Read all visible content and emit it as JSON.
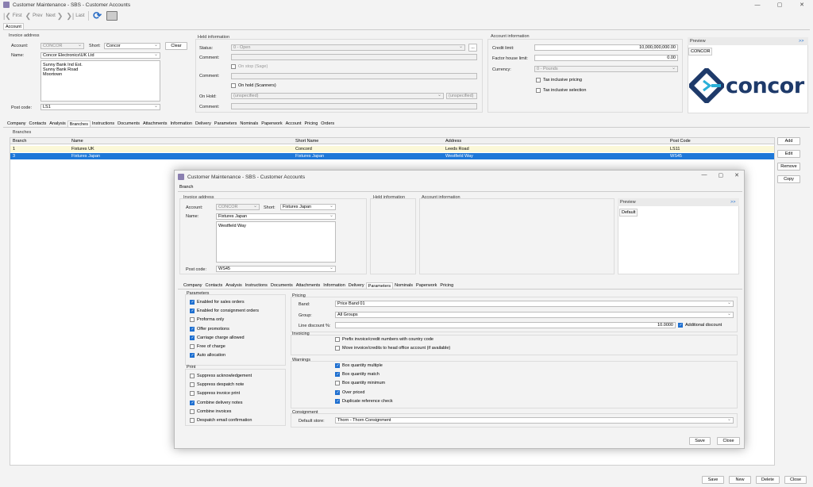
{
  "window": {
    "title": "Customer Maintenance - SBS - Customer Accounts",
    "min": "—",
    "max": "▢",
    "close": "✕"
  },
  "toolbar": {
    "first": "First",
    "prev": "Prev",
    "next": "Next",
    "last": "Last"
  },
  "top_tab": "Account",
  "invoice_address": {
    "title": "Invoice address",
    "account_label": "Account:",
    "account_value": "CONCOR",
    "short_label": "Short:",
    "short_value": "Concor",
    "clear_label": "Clear",
    "name_label": "Name:",
    "name_value": "Concor Electronics\\UK Ltd",
    "address_lines": [
      "Sunny Bank Ind Est.",
      "Sunny Bank Road",
      "Moortown"
    ],
    "postcode_label": "Post code:",
    "postcode_value": "LS1"
  },
  "held_information": {
    "title": "Held information",
    "status_label": "Status:",
    "status_value": "0 - Open",
    "comment_label": "Comment:",
    "on_stop_label": "On stop (Sage)",
    "on_hold_scanners_label": "On hold (Scanners)",
    "on_hold_label": "On Hold:",
    "on_hold_value": "(unspecified)",
    "on_hold_value2": "(unspecified)",
    "ellipsis": "..."
  },
  "account_information": {
    "title": "Account information",
    "credit_limit_label": "Credit limit:",
    "credit_limit_value": "10,000,000,000.00",
    "factor_label": "Factor house limit:",
    "factor_value": "0.00",
    "currency_label": "Currency:",
    "currency_value": "0 - Pounds",
    "tax_inclusive_pricing": "Tax inclusive pricing",
    "tax_inclusive_selection": "Tax inclusive selection"
  },
  "preview": {
    "title": "Preview",
    "expand": ">>",
    "tab": "CONCOR",
    "logo_text": "concor"
  },
  "main_tabs": [
    "Company",
    "Contacts",
    "Analysis",
    "Branches",
    "Instructions",
    "Documents",
    "Attachments",
    "Information",
    "Delivery",
    "Parameters",
    "Nominals",
    "Paperwork",
    "Account",
    "Pricing",
    "Orders"
  ],
  "branches": {
    "title": "Branches",
    "columns": [
      "Branch",
      "Name",
      "Short Name",
      "Address",
      "Post Code"
    ],
    "rows": [
      [
        "1",
        "Fixtures UK",
        "Concord",
        "Leeds Road",
        "LS11"
      ],
      [
        "3",
        "Fixtures Japan",
        "Fixtures Japan",
        "Westfield Way",
        "WS45"
      ]
    ],
    "buttons": [
      "Add",
      "Edit",
      "Remove",
      "Copy"
    ]
  },
  "footer_buttons": [
    "Save",
    "New",
    "Delete",
    "Close"
  ],
  "dialog": {
    "title": "Customer Maintenance - SBS - Customer Accounts",
    "top_tab": "Branch",
    "invoice_title": "Invoice address",
    "account_label": "Account:",
    "account_value": "CONCOR",
    "short_label": "Short:",
    "short_value": "Fixtures Japan",
    "name_label": "Name:",
    "name_value": "Fixtures Japan",
    "address_lines": [
      "Westfield Way"
    ],
    "postcode_label": "Post code:",
    "postcode_value": "WS45",
    "held_title": "Held information",
    "account_title": "Account information",
    "preview_title": "Preview",
    "preview_expand": ">>",
    "preview_tab": "Default",
    "tabs": [
      "Company",
      "Contacts",
      "Analysis",
      "Instructions",
      "Documents",
      "Attachments",
      "Information",
      "Delivery",
      "Parameters",
      "Nominals",
      "Paperwork",
      "Pricing"
    ],
    "parameters": {
      "title": "Parameters",
      "items": [
        {
          "label": "Enabled for sales orders",
          "checked": true
        },
        {
          "label": "Enabled for consignment orders",
          "checked": true
        },
        {
          "label": "Proforma only",
          "checked": false
        },
        {
          "label": "Offer promotions",
          "checked": true
        },
        {
          "label": "Carriage charge allowed",
          "checked": true
        },
        {
          "label": "Free of charge",
          "checked": false
        },
        {
          "label": "Auto allocation",
          "checked": true
        }
      ]
    },
    "print": {
      "title": "Print",
      "items": [
        {
          "label": "Suppress acknowledgement",
          "checked": false
        },
        {
          "label": "Suppress despatch note",
          "checked": false
        },
        {
          "label": "Suppress invoice print",
          "checked": false
        },
        {
          "label": "Combine delivery notes",
          "checked": true
        },
        {
          "label": "Combine invoices",
          "checked": false
        },
        {
          "label": "Despatch email confirmation",
          "checked": false
        }
      ]
    },
    "pricing": {
      "title": "Pricing",
      "band_label": "Band:",
      "band_value": "Price Band 01",
      "group_label": "Group:",
      "group_value": "All Groups",
      "discount_label": "Line discount %:",
      "discount_value": "10.0000",
      "additional_discount": "Additional discount"
    },
    "invoicing": {
      "title": "Invoicing",
      "items": [
        {
          "label": "Prefix invoice/credit numbers with country code",
          "checked": false
        },
        {
          "label": "Move invoice/credits to head office account (if available)",
          "checked": false
        }
      ]
    },
    "warnings": {
      "title": "Warnings",
      "items": [
        {
          "label": "Box quantity multiple",
          "checked": true
        },
        {
          "label": "Box quantity match",
          "checked": true
        },
        {
          "label": "Box quantity minimum",
          "checked": false
        },
        {
          "label": "Over priced",
          "checked": true
        },
        {
          "label": "Duplicate reference check",
          "checked": true
        }
      ]
    },
    "consignment": {
      "title": "Consignment",
      "store_label": "Default store:",
      "store_value": "Thorn - Thorn Consignment"
    },
    "save_label": "Save",
    "close_label": "Close"
  }
}
